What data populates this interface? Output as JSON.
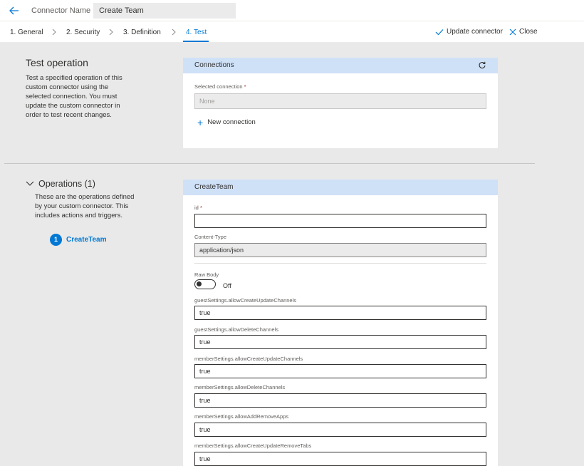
{
  "header": {
    "connector_name_label": "Connector Name",
    "connector_name_value": "Create Team"
  },
  "steps": [
    {
      "label": "1. General"
    },
    {
      "label": "2. Security"
    },
    {
      "label": "3. Definition"
    },
    {
      "label": "4. Test",
      "active": true
    }
  ],
  "commands": {
    "update": "Update connector",
    "close": "Close"
  },
  "test_operation": {
    "title": "Test operation",
    "description": "Test a specified operation of this custom connector using the selected connection. You must update the custom connector in order to test recent changes."
  },
  "connections": {
    "header": "Connections",
    "selected_label": "Selected connection",
    "required_mark": "*",
    "selected_placeholder": "None",
    "new_connection": "New connection"
  },
  "operations": {
    "title": "Operations (1)",
    "description": "These are the operations defined by your custom connector. This includes actions and triggers.",
    "items": [
      {
        "number": "1",
        "name": "CreateTeam"
      }
    ]
  },
  "create_team": {
    "header": "CreateTeam",
    "id_label": "id",
    "id_required": "*",
    "id_value": "",
    "content_type_label": "Content-Type",
    "content_type_value": "application/json",
    "raw_body_label": "Raw Body",
    "raw_body_state": "Off",
    "fields": [
      {
        "label": "guestSettings.allowCreateUpdateChannels",
        "value": "true"
      },
      {
        "label": "guestSettings.allowDeleteChannels",
        "value": "true"
      },
      {
        "label": "memberSettings.allowCreateUpdateChannels",
        "value": "true"
      },
      {
        "label": "memberSettings.allowDeleteChannels",
        "value": "true"
      },
      {
        "label": "memberSettings.allowAddRemoveApps",
        "value": "true"
      },
      {
        "label": "memberSettings.allowCreateUpdateRemoveTabs",
        "value": "true"
      }
    ]
  },
  "colors": {
    "accent": "#0078d4",
    "card_header": "#cfe1f7",
    "page_bg": "#e9e9e9"
  }
}
